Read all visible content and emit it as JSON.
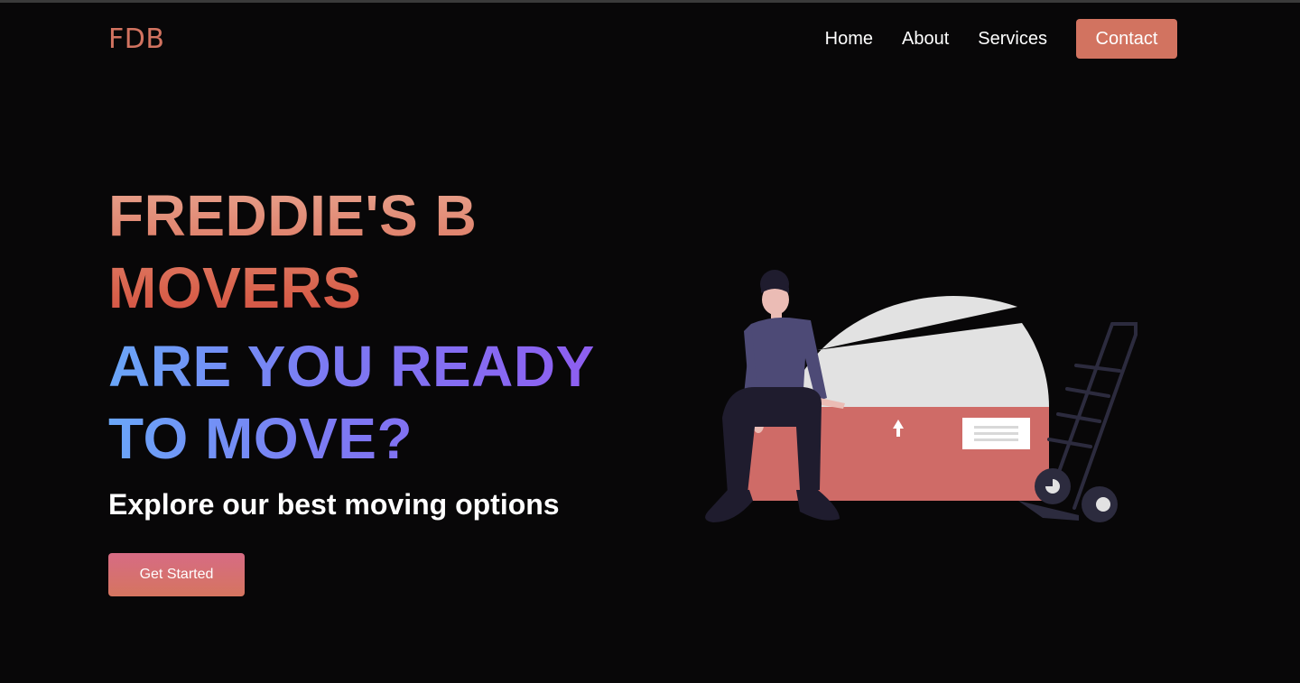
{
  "nav": {
    "logo": "FDB",
    "links": [
      "Home",
      "About",
      "Services"
    ],
    "contact_label": "Contact"
  },
  "hero": {
    "title_lines": [
      "FREDDIE'S B",
      "MOVERS"
    ],
    "subtitle_lines": [
      "ARE YOU READY",
      "TO MOVE?"
    ],
    "tagline": "Explore our best moving options",
    "cta_label": "Get Started"
  },
  "colors": {
    "background": "#080708",
    "accent": "#d27360",
    "title_gradient": [
      "#e8a590",
      "#d14e45"
    ],
    "subtitle_gradient": [
      "#6aa6f8",
      "#8e5ef0"
    ],
    "button_gradient": [
      "#d76b84",
      "#d5755f"
    ]
  },
  "illustration": {
    "icon": "mover-sitting-on-box-illustration"
  }
}
